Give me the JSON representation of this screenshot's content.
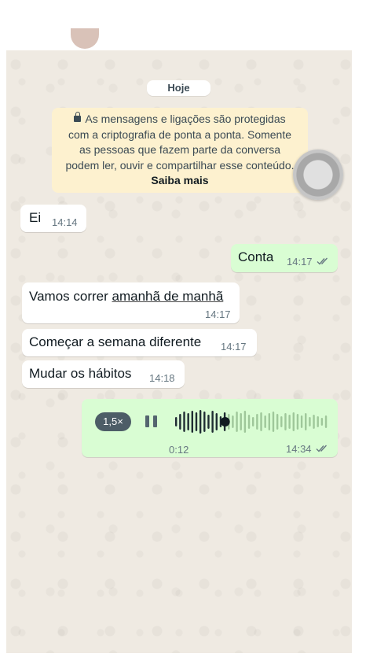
{
  "date_chip": "Hoje",
  "encryption_notice": {
    "lines": [
      "As mensagens e ligações são protegidas",
      "com a criptografia de ponta a ponta. Somente",
      "as pessoas que fazem parte da conversa",
      "podem ler, ouvir e compartilhar esse conteúdo."
    ],
    "learn_more": "Saiba mais",
    "icon": "lock-icon"
  },
  "messages": [
    {
      "direction": "in",
      "text": "Ei",
      "time": "14:14"
    },
    {
      "direction": "out",
      "text": "Conta",
      "time": "14:17",
      "status": "read"
    },
    {
      "direction": "in",
      "text_before": "Vamos correr ",
      "text_link": "amanhã de manhã",
      "time": "14:17"
    },
    {
      "direction": "in",
      "text": "Começar a semana diferente",
      "time": "14:17"
    },
    {
      "direction": "in",
      "text": "Mudar os hábitos",
      "time": "14:18"
    }
  ],
  "voice_note": {
    "speed": "1,5×",
    "duration": "0:12",
    "time": "14:34",
    "status": "read",
    "progress": 0.33,
    "icons": [
      "pause-icon",
      "waveform",
      "double-check-icon"
    ]
  },
  "colors": {
    "chat_background": "#efeae2",
    "incoming_bubble": "#ffffff",
    "outgoing_bubble": "#d9fdd3",
    "notice_background": "#fdf1cf",
    "read_tick": "#667781"
  }
}
